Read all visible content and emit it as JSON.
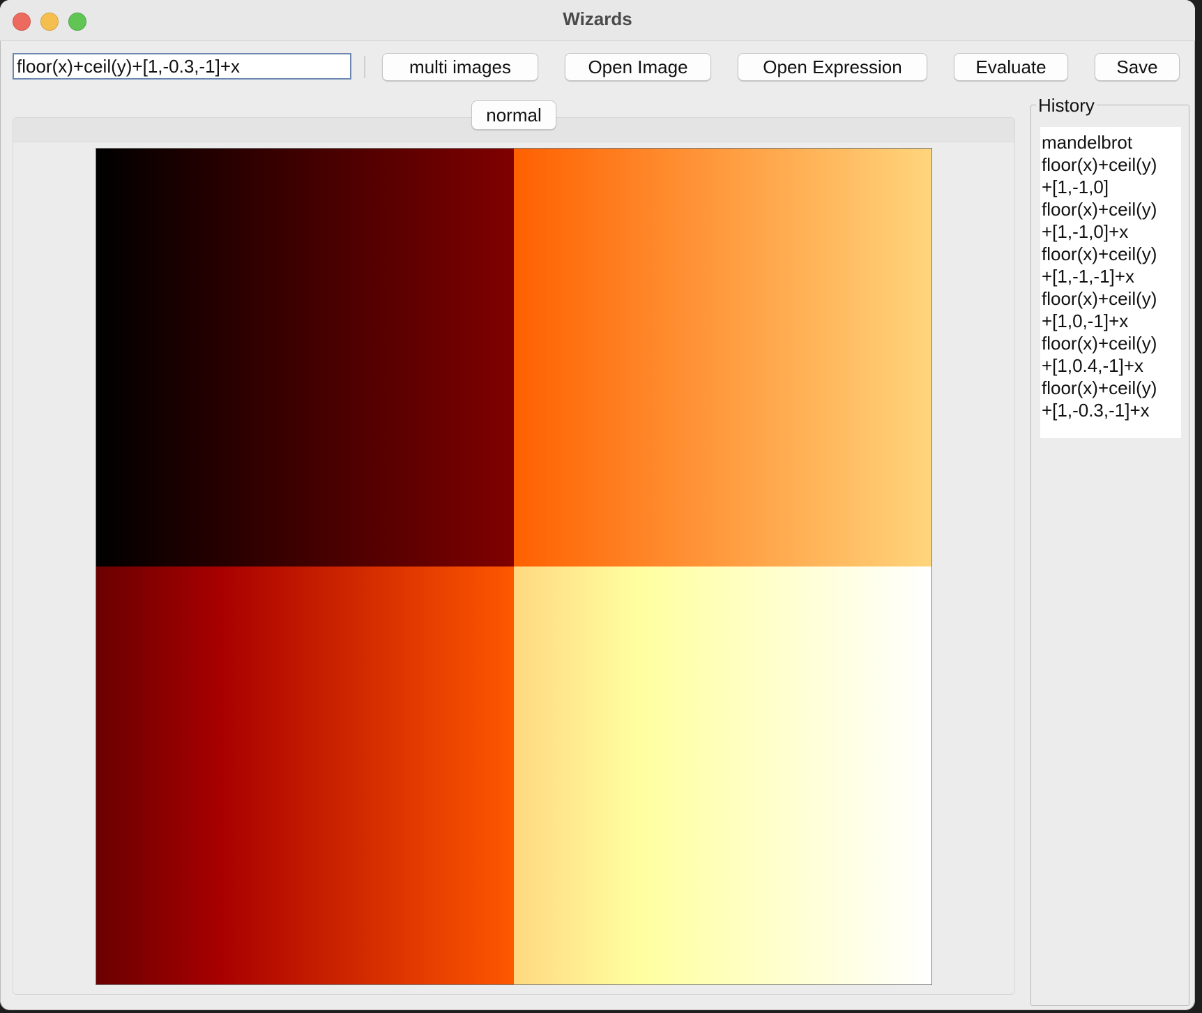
{
  "window": {
    "title": "Wizards"
  },
  "toolbar": {
    "expression_value": "floor(x)+ceil(y)+[1,-0.3,-1]+x",
    "buttons": {
      "multi_images": "multi images",
      "open_image": "Open Image",
      "open_expression": "Open Expression",
      "evaluate": "Evaluate",
      "save": "Save"
    }
  },
  "mode": {
    "label": "normal"
  },
  "image": {
    "colormap": "hot",
    "colors": [
      "#000000",
      "#800000",
      "#ff6000",
      "#ffd57c",
      "#ffffa0",
      "#ffffff"
    ]
  },
  "history": {
    "title": "History",
    "items": [
      "mandelbrot",
      "floor(x)+ceil(y)\n+[1,-1,0]",
      "floor(x)+ceil(y)\n+[1,-1,0]+x",
      "floor(x)+ceil(y)\n+[1,-1,-1]+x",
      "floor(x)+ceil(y)\n+[1,0,-1]+x",
      "floor(x)+ceil(y)\n+[1,0.4,-1]+x",
      "floor(x)+ceil(y)\n+[1,-0.3,-1]+x"
    ]
  }
}
